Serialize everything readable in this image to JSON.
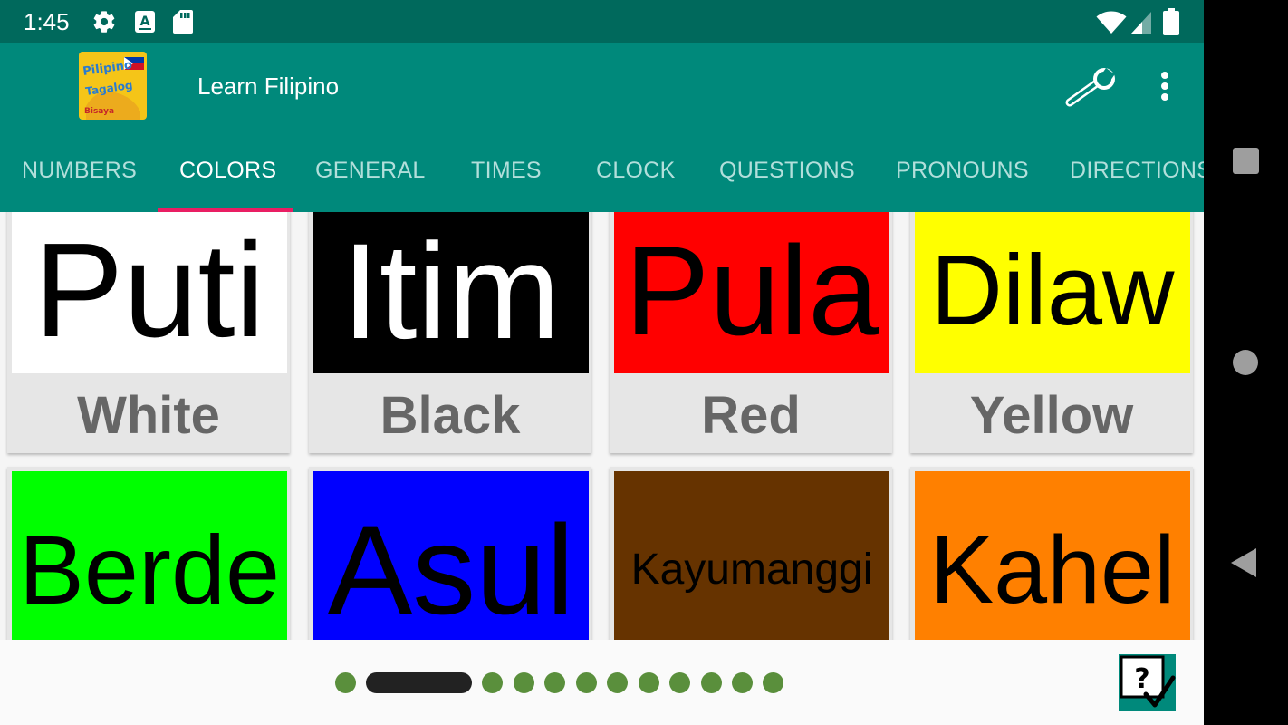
{
  "status_bar": {
    "time": "1:45",
    "icons": [
      "settings-icon",
      "keyboard-a-icon",
      "sd-card-icon",
      "wifi-icon",
      "signal-icon",
      "battery-icon"
    ]
  },
  "app_bar": {
    "title": "Learn Filipino",
    "logo": {
      "line1": "Pilipino",
      "line2": "Tagalog",
      "line3": "Bisaya"
    },
    "actions": [
      "wrench-icon",
      "more-vert-icon"
    ]
  },
  "tabs": [
    {
      "label": "NUMBERS",
      "active": false
    },
    {
      "label": "COLORS",
      "active": true
    },
    {
      "label": "GENERAL",
      "active": false
    },
    {
      "label": "TIMES",
      "active": false
    },
    {
      "label": "CLOCK",
      "active": false
    },
    {
      "label": "QUESTIONS",
      "active": false
    },
    {
      "label": "PRONOUNS",
      "active": false
    },
    {
      "label": "DIRECTIONS",
      "active": false
    }
  ],
  "cards": [
    {
      "filipino": "Puti",
      "english": "White",
      "bg": "#ffffff",
      "fg": "#000000"
    },
    {
      "filipino": "Itim",
      "english": "Black",
      "bg": "#000000",
      "fg": "#ffffff"
    },
    {
      "filipino": "Pula",
      "english": "Red",
      "bg": "#ff0000",
      "fg": "#000000"
    },
    {
      "filipino": "Dilaw",
      "english": "Yellow",
      "bg": "#ffff00",
      "fg": "#000000"
    },
    {
      "filipino": "Berde",
      "english": "",
      "bg": "#00ff00",
      "fg": "#000000"
    },
    {
      "filipino": "Asul",
      "english": "",
      "bg": "#0000ff",
      "fg": "#000000"
    },
    {
      "filipino": "Kayumanggi",
      "english": "",
      "bg": "#663300",
      "fg": "#000000"
    },
    {
      "filipino": "Kahel",
      "english": "",
      "bg": "#ff8000",
      "fg": "#000000"
    }
  ],
  "pager": {
    "pages": 12,
    "current": 2
  },
  "colors": {
    "status_bar": "#00695c",
    "app_bar": "#00897b",
    "tab_indicator": "#e91e63",
    "dot": "#5a8f3c"
  }
}
